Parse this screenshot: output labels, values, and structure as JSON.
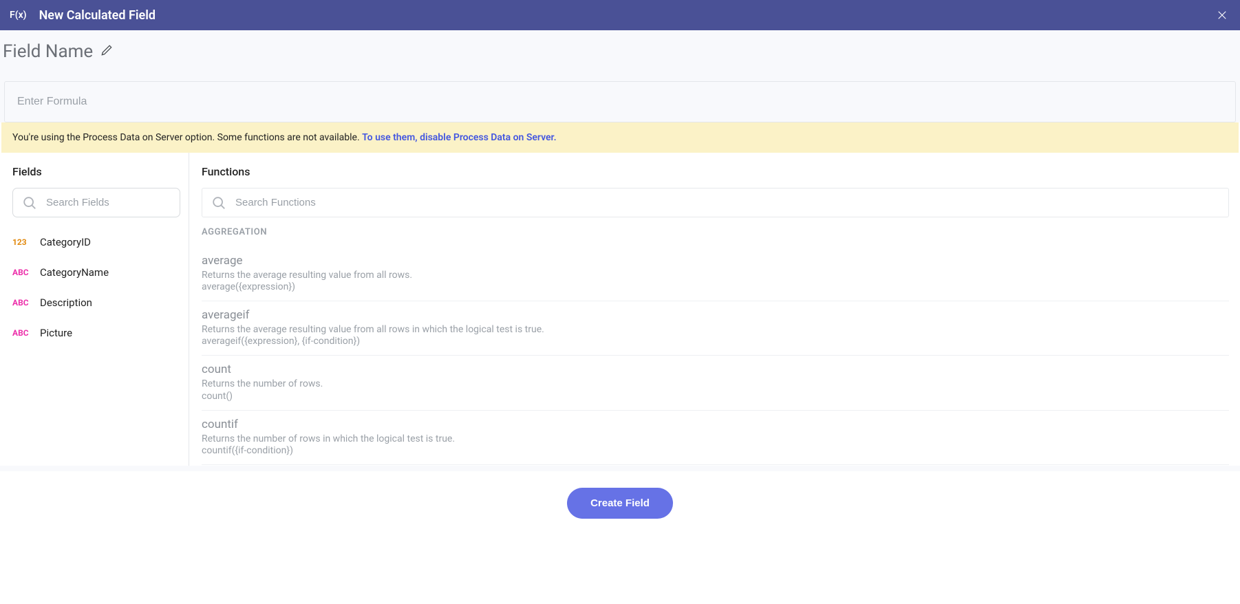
{
  "header": {
    "icon_text": "F(x)",
    "title": "New Calculated Field"
  },
  "field_name": {
    "label": "Field Name"
  },
  "formula": {
    "placeholder": "Enter Formula"
  },
  "warning": {
    "text": "You're using the Process Data on Server option. Some functions are not available. ",
    "link_text": "To use them, disable Process Data on Server."
  },
  "fields": {
    "title": "Fields",
    "search_placeholder": "Search Fields",
    "items": [
      {
        "tag": "123",
        "tagType": "num",
        "label": "CategoryID"
      },
      {
        "tag": "ABC",
        "tagType": "abc",
        "label": "CategoryName"
      },
      {
        "tag": "ABC",
        "tagType": "abc",
        "label": "Description"
      },
      {
        "tag": "ABC",
        "tagType": "abc",
        "label": "Picture"
      }
    ]
  },
  "functions": {
    "title": "Functions",
    "search_placeholder": "Search Functions",
    "group_title": "AGGREGATION",
    "items": [
      {
        "name": "average",
        "desc": "Returns the average resulting value from all rows.",
        "sig": "average({expression})"
      },
      {
        "name": "averageif",
        "desc": "Returns the average resulting value from all rows in which the logical test is true.",
        "sig": "averageif({expression}, {if-condition})"
      },
      {
        "name": "count",
        "desc": "Returns the number of rows.",
        "sig": "count()"
      },
      {
        "name": "countif",
        "desc": "Returns the number of rows in which the logical test is true.",
        "sig": "countif({if-condition})"
      }
    ]
  },
  "footer": {
    "create_label": "Create Field"
  }
}
